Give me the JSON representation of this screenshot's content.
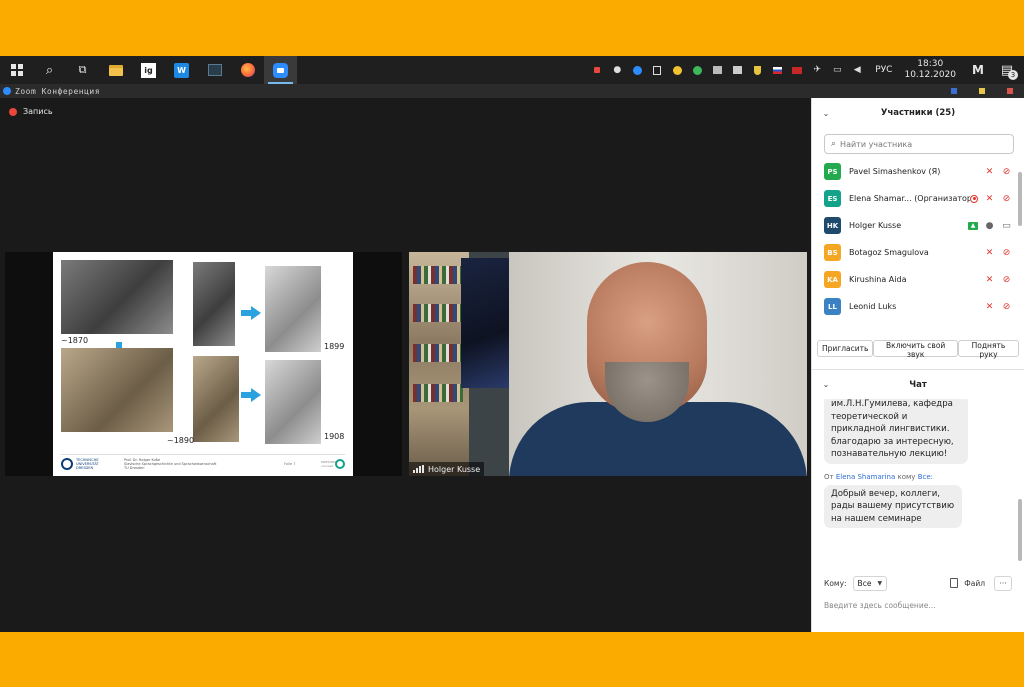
{
  "taskbar": {
    "apps": [
      {
        "name": "windows-start",
        "glyph": ""
      },
      {
        "name": "search",
        "glyph": "⌕"
      },
      {
        "name": "task-view",
        "glyph": "⧉"
      },
      {
        "name": "file-explorer",
        "glyph": ""
      },
      {
        "name": "ig-app",
        "glyph": "ig"
      },
      {
        "name": "wps-office",
        "glyph": "W"
      },
      {
        "name": "terminal",
        "glyph": ""
      },
      {
        "name": "firefox",
        "glyph": ""
      },
      {
        "name": "zoom",
        "glyph": ""
      }
    ],
    "language": "РУС",
    "time": "18:30",
    "date": "10.12.2020",
    "notifications_count": "3",
    "app_label": "M"
  },
  "zoom": {
    "window_title": "Zoom Конференция",
    "recording_label": "Запись",
    "colors": {
      "accent": "#2d8cff",
      "record": "#e8483c",
      "muted": "#e0342e"
    }
  },
  "slide": {
    "years": [
      "~1870",
      "1899",
      "~1890",
      "1908"
    ],
    "footer_university": "TECHNISCHE UNIVERSITÄT DRESDEN",
    "footer_lines": [
      "Prof. Dr. Holger Kuße",
      "Slavische Sprachgeschichte und Sprachwissenschaft",
      "TU Dresden"
    ],
    "footer_page": "Folie 7",
    "footer_logo_text": "DRESDEN concept"
  },
  "video": {
    "speaker_name": "Holger Kusse"
  },
  "participants": {
    "title": "Участники (25)",
    "search_placeholder": "Найти участника",
    "list": [
      {
        "initials": "PS",
        "name": "Pavel Simashenkov (Я)",
        "color": "#23a94e",
        "status": "muted"
      },
      {
        "initials": "ES",
        "name": "Elena Shamar... (Организатор)",
        "color": "#13a38a",
        "status": "muted-recording"
      },
      {
        "initials": "HK",
        "name": "Holger Kusse",
        "color": "#1e4a6e",
        "status": "sharing"
      },
      {
        "initials": "BS",
        "name": "Botagoz Smagulova",
        "color": "#f5a623",
        "status": "muted"
      },
      {
        "initials": "KA",
        "name": "Kirushina Aida",
        "color": "#f5a623",
        "status": "muted"
      },
      {
        "initials": "LL",
        "name": "Leonid Luks",
        "color": "#3b82c4",
        "status": "muted"
      }
    ],
    "buttons": {
      "invite": "Пригласить",
      "unmute": "Включить свой звук",
      "raise_hand": "Поднять руку"
    }
  },
  "chat": {
    "title": "Чат",
    "messages": [
      {
        "text": "им.Л.Н.Гумилева, кафедра теоретической и прикладной лингвистики. благодарю за интересную, познавательную лекцию!"
      },
      {
        "from_prefix": "От",
        "from": "Elena Shamarina",
        "to_prefix": "кому",
        "to": "Все:",
        "text": "Добрый вечер, коллеги, рады вашему присутствию на нашем семинаре"
      }
    ],
    "to_label": "Кому:",
    "to_value": "Все",
    "file_label": "Файл",
    "more_label": "···",
    "input_placeholder": "Введите здесь сообщение..."
  }
}
